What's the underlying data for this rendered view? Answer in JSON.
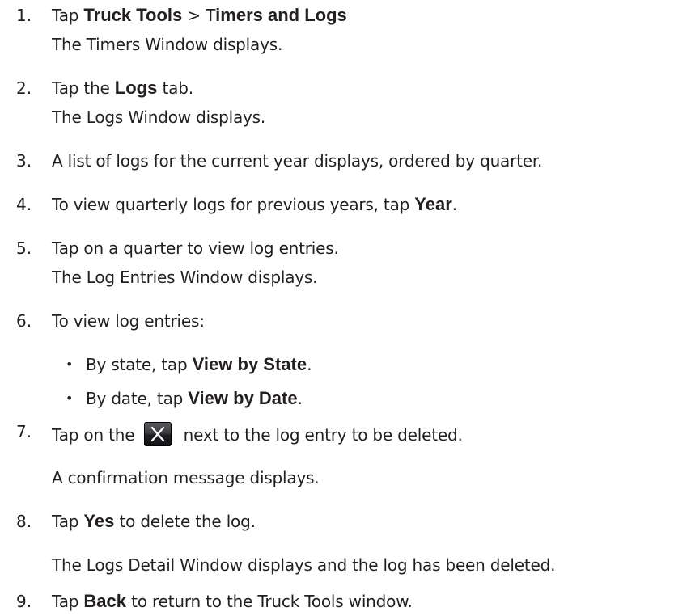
{
  "steps": [
    {
      "num": "1.",
      "parts": [
        "Tap ",
        "Truck Tools",
        " > T",
        "imers and Logs"
      ],
      "sub": "The Timers Window displays."
    },
    {
      "num": "2.",
      "parts": [
        "Tap the ",
        "Logs",
        " tab."
      ],
      "sub": "The Logs Window displays."
    },
    {
      "num": "3.",
      "text": "A list of logs for the current year displays, ordered by quarter."
    },
    {
      "num": "4.",
      "parts": [
        "To view quarterly logs for previous years, tap ",
        "Year",
        "."
      ]
    },
    {
      "num": "5.",
      "text": "Tap on a quarter to view log entries.",
      "sub": "The Log Entries Window displays."
    },
    {
      "num": "6.",
      "text": "To view log entries:",
      "bullets": [
        {
          "parts": [
            "By state, tap ",
            "View by State",
            "."
          ]
        },
        {
          "parts": [
            "By date, tap ",
            "View by Date",
            "."
          ]
        }
      ]
    },
    {
      "num": "7.",
      "parts": [
        "Tap on the ",
        " next to the log entry to be deleted."
      ],
      "icon": "close-icon",
      "sub": "A confirmation message displays."
    },
    {
      "num": "8.",
      "parts": [
        "Tap ",
        "Yes",
        " to delete the log."
      ],
      "sub": "The Logs Detail Window displays and the log has been deleted."
    },
    {
      "num": "9.",
      "parts": [
        "Tap ",
        "Back",
        " to return to the Truck Tools window."
      ]
    }
  ],
  "bullet_char": "•"
}
